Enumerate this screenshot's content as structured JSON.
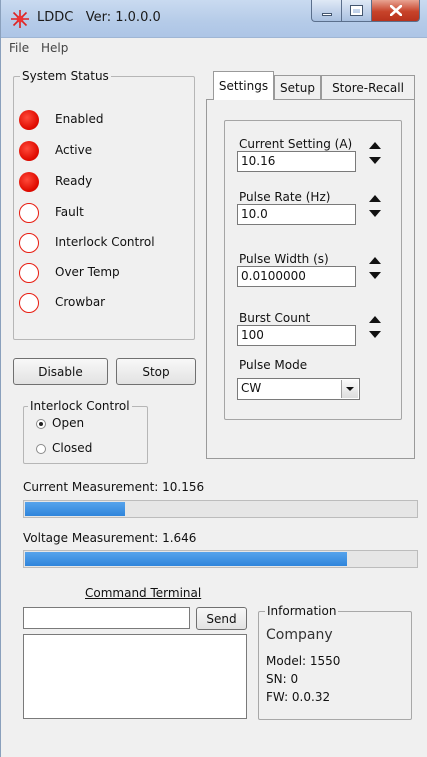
{
  "window": {
    "app_name": "LDDC",
    "version": "Ver: 1.0.0.0"
  },
  "menu": {
    "file": "File",
    "help": "Help"
  },
  "system_status": {
    "title": "System Status",
    "items": [
      {
        "label": "Enabled",
        "state": "on"
      },
      {
        "label": "Active",
        "state": "on"
      },
      {
        "label": "Ready",
        "state": "on"
      },
      {
        "label": "Fault",
        "state": "off"
      },
      {
        "label": "Interlock Control",
        "state": "off"
      },
      {
        "label": "Over Temp",
        "state": "off"
      },
      {
        "label": "Crowbar",
        "state": "off"
      }
    ]
  },
  "buttons": {
    "disable": "Disable",
    "stop": "Stop",
    "send": "Send"
  },
  "interlock": {
    "title": "Interlock Control",
    "options": [
      "Open",
      "Closed"
    ],
    "selected": "Open"
  },
  "tabs": {
    "items": [
      "Settings",
      "Setup",
      "Store-Recall"
    ],
    "active": "Settings"
  },
  "settings": {
    "current_label": "Current Setting (A)",
    "current_value": "10.16",
    "pulse_rate_label": "Pulse Rate (Hz)",
    "pulse_rate_value": "10.0",
    "pulse_width_label": "Pulse Width (s)",
    "pulse_width_value": "0.0100000",
    "burst_count_label": "Burst Count",
    "burst_count_value": "100",
    "pulse_mode_label": "Pulse Mode",
    "pulse_mode_value": "CW"
  },
  "measurements": {
    "current_label": "Current Measurement: 10.156",
    "current_fraction": 0.255,
    "voltage_label": "Voltage Measurement: 1.646",
    "voltage_fraction": 0.82
  },
  "terminal": {
    "title": "Command Terminal",
    "input_value": "",
    "output": ""
  },
  "information": {
    "title": "Information",
    "company": "Company",
    "model": "Model: 1550",
    "sn": "SN: 0",
    "fw": "FW: 0.0.32"
  },
  "colors": {
    "led_on": "#e00b00",
    "led_off_ring": "#e81c10",
    "progress_fill": "#2f85db",
    "title_bar": "#b5cbe8",
    "close_button": "#c7432a"
  }
}
